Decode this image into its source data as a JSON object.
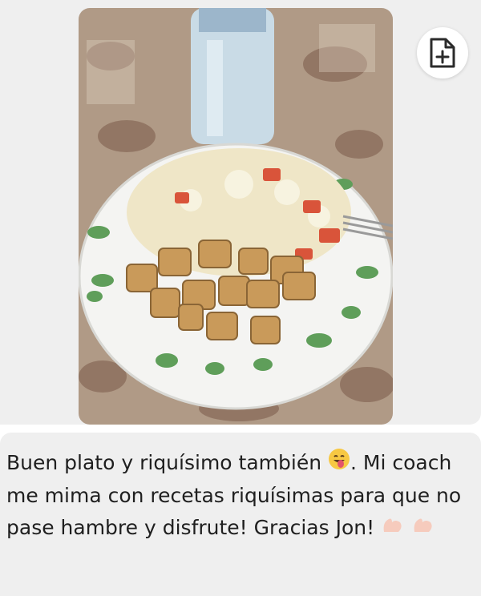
{
  "photo": {
    "alt": "Plato con pollo a la plancha, arroz y tomate"
  },
  "actions": {
    "save_icon": "file-plus-icon"
  },
  "message": {
    "part1": "Buen plato y riquísimo también ",
    "emoji_face": "face-tongue-emoji",
    "part2": ". Mi coach me mima con recetas riquísimas para que no pase hambre y disfrute! Gracias Jon! ",
    "emoji_muscles": "flexed-biceps-emoji"
  },
  "colors": {
    "bubble": "#efefef",
    "text": "#1f1f1f"
  }
}
